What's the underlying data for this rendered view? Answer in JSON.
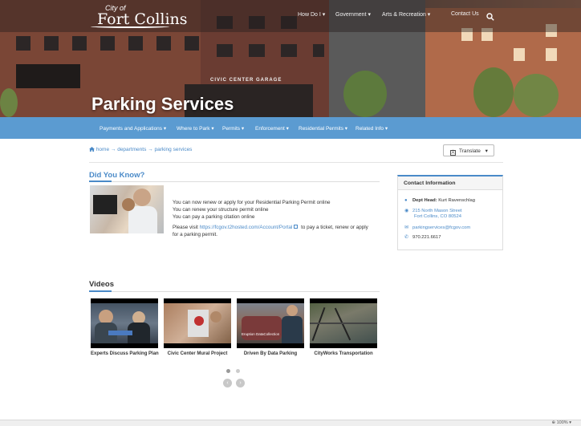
{
  "header": {
    "logo_city": "City of",
    "logo_name": "Fort Collins",
    "nav": [
      {
        "label": "How Do I ▾"
      },
      {
        "label": "Government ▾"
      },
      {
        "label": "Arts & Recreation ▾"
      },
      {
        "label": "Contact Us"
      }
    ],
    "garage_sign": "CIVIC CENTER GARAGE",
    "page_title": "Parking Services"
  },
  "subnav": [
    {
      "label": "Payments and Applications ▾"
    },
    {
      "label": "Where to Park ▾"
    },
    {
      "label": "Permits ▾"
    },
    {
      "label": "Enforcement ▾"
    },
    {
      "label": "Residential Permits ▾"
    },
    {
      "label": "Related Info ▾"
    }
  ],
  "breadcrumb": {
    "home": "home",
    "sep": "→",
    "departments": "departments",
    "current": "parking services"
  },
  "translate": {
    "label": "Translate",
    "caret": "▾"
  },
  "did_you_know": {
    "title": "Did You Know?",
    "lines": [
      "You can now renew or apply for your Residential Parking Permit online",
      "You can renew your structure permit online",
      "You can pay a parking citation online"
    ],
    "visit_prefix": "Please visit ",
    "visit_link": "https://fcgov.t2hosted.com/Account/Portal",
    "visit_suffix": " to pay a ticket, renew or apply",
    "visit_line2": "for a parking permit."
  },
  "contact": {
    "title": "Contact Information",
    "dept_head_label": "Dept Head:",
    "dept_head_name": "Kurt Ravenschlag",
    "address_line1": "215 North Mason Street",
    "address_line2": "Fort Collins, CO 80524",
    "email": "parkingservices@fcgov.com",
    "phone": "970.221.6617"
  },
  "videos": {
    "title": "Videos",
    "items": [
      {
        "label": "Experts Discuss Parking Plan"
      },
      {
        "label": "Civic Center Mural Project"
      },
      {
        "label": "Driven By Data Parking",
        "overlay": "Eruption DataCollection"
      },
      {
        "label": "CityWorks Transportation"
      }
    ],
    "prev": "‹",
    "next": "›"
  },
  "statusbar": {
    "zoom": "100%",
    "zoom_caret": "▾"
  },
  "colors": {
    "accent": "#4a8ac8",
    "nav_blue": "#5b9bd1"
  }
}
